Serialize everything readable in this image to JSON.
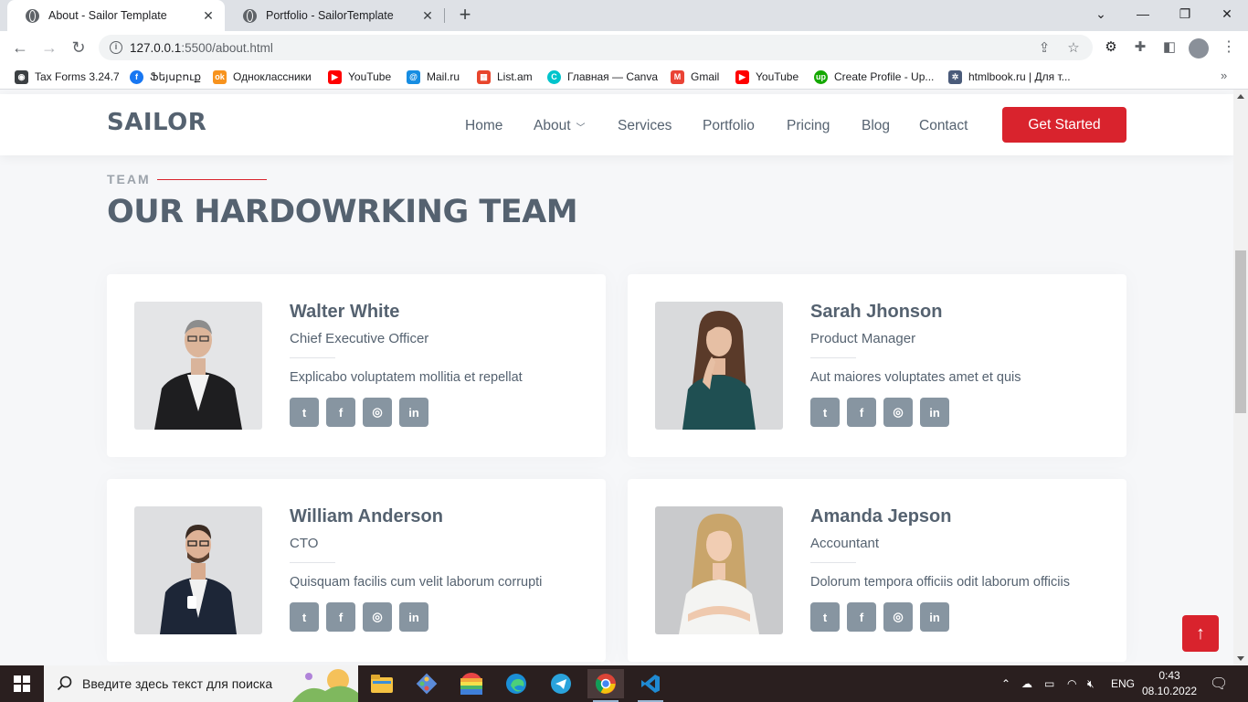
{
  "browser": {
    "tabs": [
      {
        "title": "About - Sailor Template",
        "active": true
      },
      {
        "title": "Portfolio - SailorTemplate",
        "active": false
      }
    ],
    "url_host": "127.0.0.1",
    "url_rest": ":5500/about.html",
    "bookmarks": [
      {
        "label": "Tax Forms 3.24.7",
        "color": "#3c4043",
        "glyph": "◉"
      },
      {
        "label": "Ֆեյսբուք",
        "color": "#1877f2",
        "glyph": "f"
      },
      {
        "label": "Одноклассники",
        "color": "#f7931e",
        "glyph": "ok"
      },
      {
        "label": "YouTube",
        "color": "#ff0000",
        "glyph": "▶"
      },
      {
        "label": "Mail.ru",
        "color": "#168de2",
        "glyph": "@"
      },
      {
        "label": "List.am",
        "color": "#e8452c",
        "glyph": "▦"
      },
      {
        "label": "Главная — Canva",
        "color": "#00c4cc",
        "glyph": "C"
      },
      {
        "label": "Gmail",
        "color": "#ea4335",
        "glyph": "M"
      },
      {
        "label": "YouTube",
        "color": "#ff0000",
        "glyph": "▶"
      },
      {
        "label": "Create Profile - Up...",
        "color": "#14a800",
        "glyph": "up"
      },
      {
        "label": "htmlbook.ru | Для т...",
        "color": "#4a5b7a",
        "glyph": "✲"
      }
    ]
  },
  "site": {
    "logo": "SAILOR",
    "nav": [
      "Home",
      "About",
      "Services",
      "Portfolio",
      "Pricing",
      "Blog",
      "Contact"
    ],
    "cta": "Get Started",
    "accent": "#d9232d"
  },
  "section": {
    "label": "TEAM",
    "title": "OUR HARDOWRKING TEAM"
  },
  "team": [
    {
      "name": "Walter White",
      "role": "Chief Executive Officer",
      "bio": "Explicabo voluptatem mollitia et repellat"
    },
    {
      "name": "Sarah Jhonson",
      "role": "Product Manager",
      "bio": "Aut maiores voluptates amet et quis"
    },
    {
      "name": "William Anderson",
      "role": "CTO",
      "bio": "Quisquam facilis cum velit laborum corrupti"
    },
    {
      "name": "Amanda Jepson",
      "role": "Accountant",
      "bio": "Dolorum tempora officiis odit laborum officiis"
    }
  ],
  "social_icons": [
    "twitter-icon",
    "facebook-icon",
    "instagram-icon",
    "linkedin-icon"
  ],
  "taskbar": {
    "search_placeholder": "Введите здесь текст для поиска",
    "lang": "ENG",
    "time": "0:43",
    "date": "08.10.2022"
  }
}
